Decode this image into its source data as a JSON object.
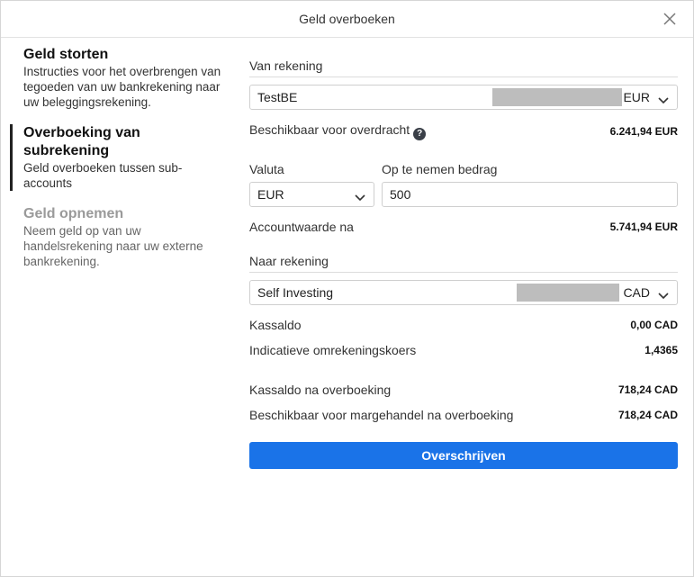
{
  "dialog": {
    "title": "Geld overboeken"
  },
  "sidebar": {
    "items": [
      {
        "title": "Geld storten",
        "desc": "Instructies voor het overbrengen van tegoeden van uw bankrekening naar uw beleggingsrekening.",
        "state": "normal"
      },
      {
        "title": "Overboeking van subrekening",
        "desc": "Geld overboeken tussen sub-accounts",
        "state": "active"
      },
      {
        "title": "Geld opnemen",
        "desc": "Neem geld op van uw handelsrekening naar uw externe bankrekening.",
        "state": "disabled"
      }
    ]
  },
  "from": {
    "label": "Van rekening",
    "account": "TestBE",
    "currency": "EUR"
  },
  "available": {
    "label": "Beschikbaar voor overdracht",
    "help_icon": "?",
    "value": "6.241,94 EUR"
  },
  "currency_field": {
    "label": "Valuta",
    "value": "EUR"
  },
  "amount_field": {
    "label": "Op te nemen bedrag",
    "value": "500"
  },
  "account_value_after": {
    "label": "Accountwaarde na",
    "value": "5.741,94 EUR"
  },
  "to": {
    "label": "Naar rekening",
    "account": "Self Investing",
    "currency": "CAD"
  },
  "cash_balance": {
    "label": "Kassaldo",
    "value": "0,00 CAD"
  },
  "fx_rate": {
    "label": "Indicatieve omrekeningskoers",
    "value": "1,4365"
  },
  "cash_after": {
    "label": "Kassaldo na overboeking",
    "value": "718,24 CAD"
  },
  "margin_after": {
    "label": "Beschikbaar voor margehandel na overboeking",
    "value": "718,24 CAD"
  },
  "submit": {
    "label": "Overschrijven",
    "color": "#1a73e8"
  }
}
